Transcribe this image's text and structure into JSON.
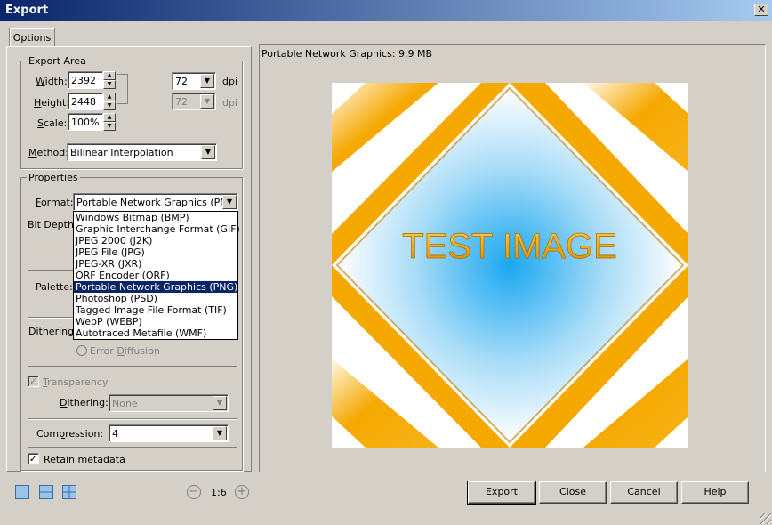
{
  "window": {
    "title": "Export",
    "close_glyph": "✕"
  },
  "tabs": [
    {
      "label": "Options"
    }
  ],
  "export_area": {
    "title": "Export Area",
    "width": {
      "label_u": "W",
      "label_rest": "idth:",
      "value": "2392"
    },
    "height": {
      "label_u": "H",
      "label_rest": "eight:",
      "value": "2448"
    },
    "scale": {
      "label_u": "S",
      "label_rest": "cale:",
      "value": "100%"
    },
    "dpi1": {
      "value": "72",
      "unit": "dpi"
    },
    "dpi2": {
      "value": "72",
      "unit": "dpi"
    },
    "method": {
      "label_u": "M",
      "label_rest": "ethod:",
      "value": "Bilinear Interpolation"
    }
  },
  "properties": {
    "title": "Properties",
    "format": {
      "label_pre": "",
      "label_u": "F",
      "label_rest": "ormat:",
      "value": "Portable Network Graphics (PNG)"
    },
    "format_options": [
      "Windows Bitmap (BMP)",
      "Graphic Interchange Format (GIF)",
      "JPEG 2000 (J2K)",
      "JPEG File (JPG)",
      "JPEG-XR (JXR)",
      "ORF Encoder (ORF)",
      "Portable Network Graphics (PNG)",
      "Photoshop (PSD)",
      "Tagged Image File Format (TIF)",
      "WebP (WEBP)",
      "Autotraced Metafile (WMF)"
    ],
    "selected_index": 6,
    "bit_depth_label": "Bit Depth:",
    "palette_label": "Palette:",
    "dithering_label": "Dithering:",
    "error_diffusion_u": "D",
    "error_diffusion_pre": "Error ",
    "error_diffusion_rest": "iffusion",
    "transparency": {
      "label_u": "T",
      "label_rest": "ransparency",
      "checked": true
    },
    "transp_dithering": {
      "label_u": "D",
      "label_rest": "ithering:",
      "value": "None"
    },
    "compression": {
      "label_pre": "Com",
      "label_u": "p",
      "label_rest": "ression:",
      "value": "4"
    },
    "retain_metadata": {
      "label": "Retain metadata",
      "checked": true
    }
  },
  "preview": {
    "info": "Portable Network Graphics:   9.9 MB",
    "image_text": "TEST IMAGE"
  },
  "zoom": {
    "value": "1:6",
    "minus": "−",
    "plus": "+"
  },
  "buttons": {
    "export": "Export",
    "close": "Close",
    "cancel": "Cancel",
    "help": "Help"
  },
  "colors": {
    "accent": "#0a246a",
    "orange": "#f5a800",
    "blue": "#1aa8f0"
  },
  "icons": [
    "single-view-icon",
    "split-horizontal-icon",
    "quad-view-icon",
    "zoom-out-icon",
    "zoom-in-icon"
  ]
}
